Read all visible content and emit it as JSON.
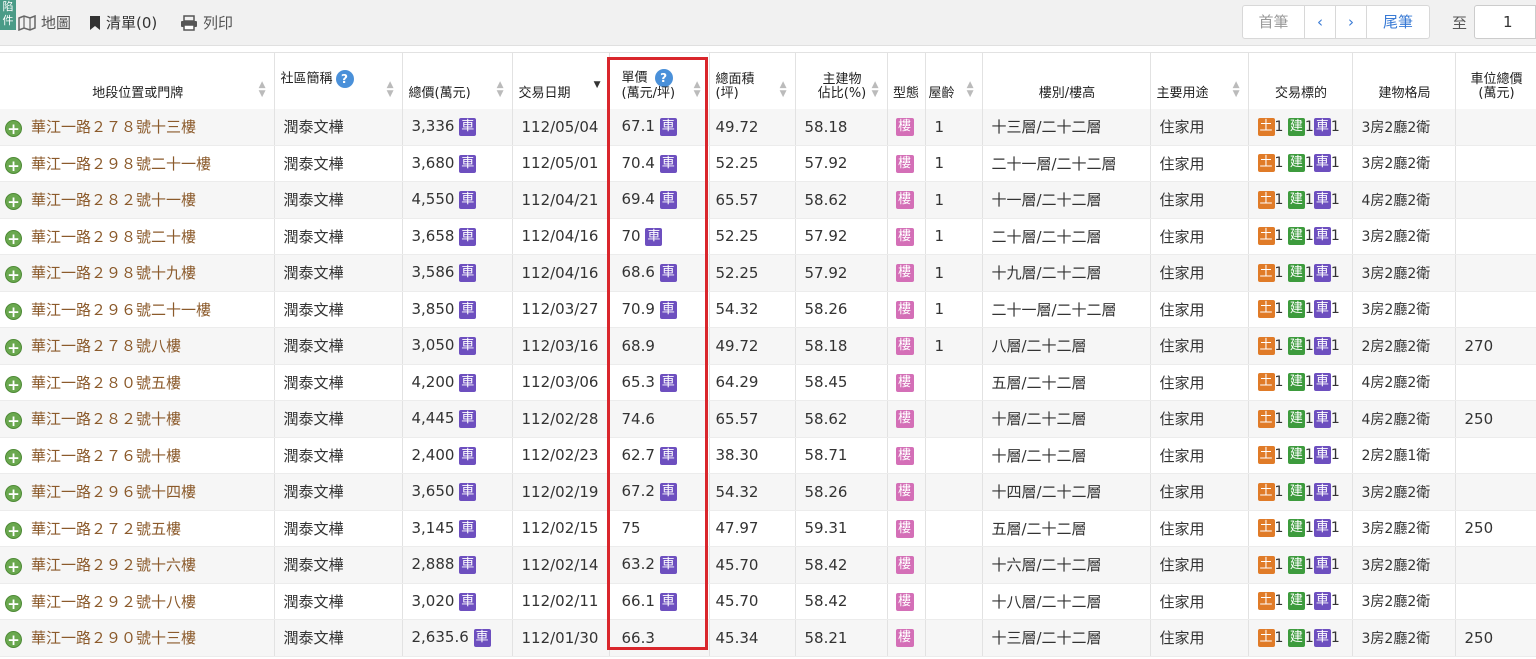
{
  "toolbar": {
    "corner_tag": "陷件",
    "map_label": "地圖",
    "list_label": "清單(0)",
    "print_label": "列印"
  },
  "pager": {
    "first": "首筆",
    "prev": "‹",
    "next": "›",
    "last": "尾筆",
    "goto_label": "至",
    "goto_value": "1"
  },
  "table": {
    "headers": {
      "address": "地段位置或門牌",
      "community": "社區簡稱",
      "total_price": "總價(萬元)",
      "date": "交易日期",
      "unit_price_1": "單價",
      "unit_price_2": "(萬元/坪)",
      "area_1": "總面積",
      "area_2": "(坪)",
      "main_ratio_1": "主建物",
      "main_ratio_2": "佔比(%)",
      "type": "型態",
      "age": "屋齡",
      "floor": "樓別/樓高",
      "usage": "主要用途",
      "target": "交易標的",
      "layout": "建物格局",
      "parking_1": "車位總價",
      "parking_2": "(萬元)"
    },
    "badges": {
      "car": "車",
      "bldg": "樓",
      "land": "土",
      "build": "建"
    },
    "rows": [
      {
        "address": "華江一路２７８號十三樓",
        "community": "潤泰文樺",
        "total": "3,336",
        "total_car": true,
        "date": "112/05/04",
        "unit": "67.1",
        "unit_car": true,
        "area": "49.72",
        "ratio": "58.18",
        "age": "1",
        "floor": "十三層/二十二層",
        "usage": "住家用",
        "land": "1",
        "build": "1",
        "car": "1",
        "layout": "3房2廳2衛",
        "parking": ""
      },
      {
        "address": "華江一路２９８號二十一樓",
        "community": "潤泰文樺",
        "total": "3,680",
        "total_car": true,
        "date": "112/05/01",
        "unit": "70.4",
        "unit_car": true,
        "area": "52.25",
        "ratio": "57.92",
        "age": "1",
        "floor": "二十一層/二十二層",
        "usage": "住家用",
        "land": "1",
        "build": "1",
        "car": "1",
        "layout": "3房2廳2衛",
        "parking": ""
      },
      {
        "address": "華江一路２８２號十一樓",
        "community": "潤泰文樺",
        "total": "4,550",
        "total_car": true,
        "date": "112/04/21",
        "unit": "69.4",
        "unit_car": true,
        "area": "65.57",
        "ratio": "58.62",
        "age": "1",
        "floor": "十一層/二十二層",
        "usage": "住家用",
        "land": "1",
        "build": "1",
        "car": "1",
        "layout": "4房2廳2衛",
        "parking": ""
      },
      {
        "address": "華江一路２９８號二十樓",
        "community": "潤泰文樺",
        "total": "3,658",
        "total_car": true,
        "date": "112/04/16",
        "unit": "70",
        "unit_car": true,
        "area": "52.25",
        "ratio": "57.92",
        "age": "1",
        "floor": "二十層/二十二層",
        "usage": "住家用",
        "land": "1",
        "build": "1",
        "car": "1",
        "layout": "3房2廳2衛",
        "parking": ""
      },
      {
        "address": "華江一路２９８號十九樓",
        "community": "潤泰文樺",
        "total": "3,586",
        "total_car": true,
        "date": "112/04/16",
        "unit": "68.6",
        "unit_car": true,
        "area": "52.25",
        "ratio": "57.92",
        "age": "1",
        "floor": "十九層/二十二層",
        "usage": "住家用",
        "land": "1",
        "build": "1",
        "car": "1",
        "layout": "3房2廳2衛",
        "parking": ""
      },
      {
        "address": "華江一路２９６號二十一樓",
        "community": "潤泰文樺",
        "total": "3,850",
        "total_car": true,
        "date": "112/03/27",
        "unit": "70.9",
        "unit_car": true,
        "area": "54.32",
        "ratio": "58.26",
        "age": "1",
        "floor": "二十一層/二十二層",
        "usage": "住家用",
        "land": "1",
        "build": "1",
        "car": "1",
        "layout": "3房2廳2衛",
        "parking": ""
      },
      {
        "address": "華江一路２７８號八樓",
        "community": "潤泰文樺",
        "total": "3,050",
        "total_car": true,
        "date": "112/03/16",
        "unit": "68.9",
        "unit_car": false,
        "area": "49.72",
        "ratio": "58.18",
        "age": "1",
        "floor": "八層/二十二層",
        "usage": "住家用",
        "land": "1",
        "build": "1",
        "car": "1",
        "layout": "2房2廳2衛",
        "parking": "270"
      },
      {
        "address": "華江一路２８０號五樓",
        "community": "潤泰文樺",
        "total": "4,200",
        "total_car": true,
        "date": "112/03/06",
        "unit": "65.3",
        "unit_car": true,
        "area": "64.29",
        "ratio": "58.45",
        "age": "",
        "floor": "五層/二十二層",
        "usage": "住家用",
        "land": "1",
        "build": "1",
        "car": "1",
        "layout": "4房2廳2衛",
        "parking": ""
      },
      {
        "address": "華江一路２８２號十樓",
        "community": "潤泰文樺",
        "total": "4,445",
        "total_car": true,
        "date": "112/02/28",
        "unit": "74.6",
        "unit_car": false,
        "area": "65.57",
        "ratio": "58.62",
        "age": "",
        "floor": "十層/二十二層",
        "usage": "住家用",
        "land": "1",
        "build": "1",
        "car": "1",
        "layout": "4房2廳2衛",
        "parking": "250"
      },
      {
        "address": "華江一路２７６號十樓",
        "community": "潤泰文樺",
        "total": "2,400",
        "total_car": true,
        "date": "112/02/23",
        "unit": "62.7",
        "unit_car": true,
        "area": "38.30",
        "ratio": "58.71",
        "age": "",
        "floor": "十層/二十二層",
        "usage": "住家用",
        "land": "1",
        "build": "1",
        "car": "1",
        "layout": "2房2廳1衛",
        "parking": ""
      },
      {
        "address": "華江一路２９６號十四樓",
        "community": "潤泰文樺",
        "total": "3,650",
        "total_car": true,
        "date": "112/02/19",
        "unit": "67.2",
        "unit_car": true,
        "area": "54.32",
        "ratio": "58.26",
        "age": "",
        "floor": "十四層/二十二層",
        "usage": "住家用",
        "land": "1",
        "build": "1",
        "car": "1",
        "layout": "3房2廳2衛",
        "parking": ""
      },
      {
        "address": "華江一路２７２號五樓",
        "community": "潤泰文樺",
        "total": "3,145",
        "total_car": true,
        "date": "112/02/15",
        "unit": "75",
        "unit_car": false,
        "area": "47.97",
        "ratio": "59.31",
        "age": "",
        "floor": "五層/二十二層",
        "usage": "住家用",
        "land": "1",
        "build": "1",
        "car": "1",
        "layout": "3房2廳2衛",
        "parking": "250"
      },
      {
        "address": "華江一路２９２號十六樓",
        "community": "潤泰文樺",
        "total": "2,888",
        "total_car": true,
        "date": "112/02/14",
        "unit": "63.2",
        "unit_car": true,
        "area": "45.70",
        "ratio": "58.42",
        "age": "",
        "floor": "十六層/二十二層",
        "usage": "住家用",
        "land": "1",
        "build": "1",
        "car": "1",
        "layout": "3房2廳2衛",
        "parking": ""
      },
      {
        "address": "華江一路２９２號十八樓",
        "community": "潤泰文樺",
        "total": "3,020",
        "total_car": true,
        "date": "112/02/11",
        "unit": "66.1",
        "unit_car": true,
        "area": "45.70",
        "ratio": "58.42",
        "age": "",
        "floor": "十八層/二十二層",
        "usage": "住家用",
        "land": "1",
        "build": "1",
        "car": "1",
        "layout": "3房2廳2衛",
        "parking": ""
      },
      {
        "address": "華江一路２９０號十三樓",
        "community": "潤泰文樺",
        "total": "2,635.6",
        "total_car": true,
        "date": "112/01/30",
        "unit": "66.3",
        "unit_car": false,
        "area": "45.34",
        "ratio": "58.21",
        "age": "",
        "floor": "十三層/二十二層",
        "usage": "住家用",
        "land": "1",
        "build": "1",
        "car": "1",
        "layout": "3房2廳2衛",
        "parking": "250"
      }
    ]
  },
  "colors": {
    "highlight_border": "#d9262c",
    "address_text": "#8b5a2b",
    "car_badge": "#6d4fbf",
    "building_badge": "#d46fb7",
    "land_badge": "#e07b28",
    "build_badge": "#3d9b3d",
    "link_blue": "#3a7bd5"
  }
}
